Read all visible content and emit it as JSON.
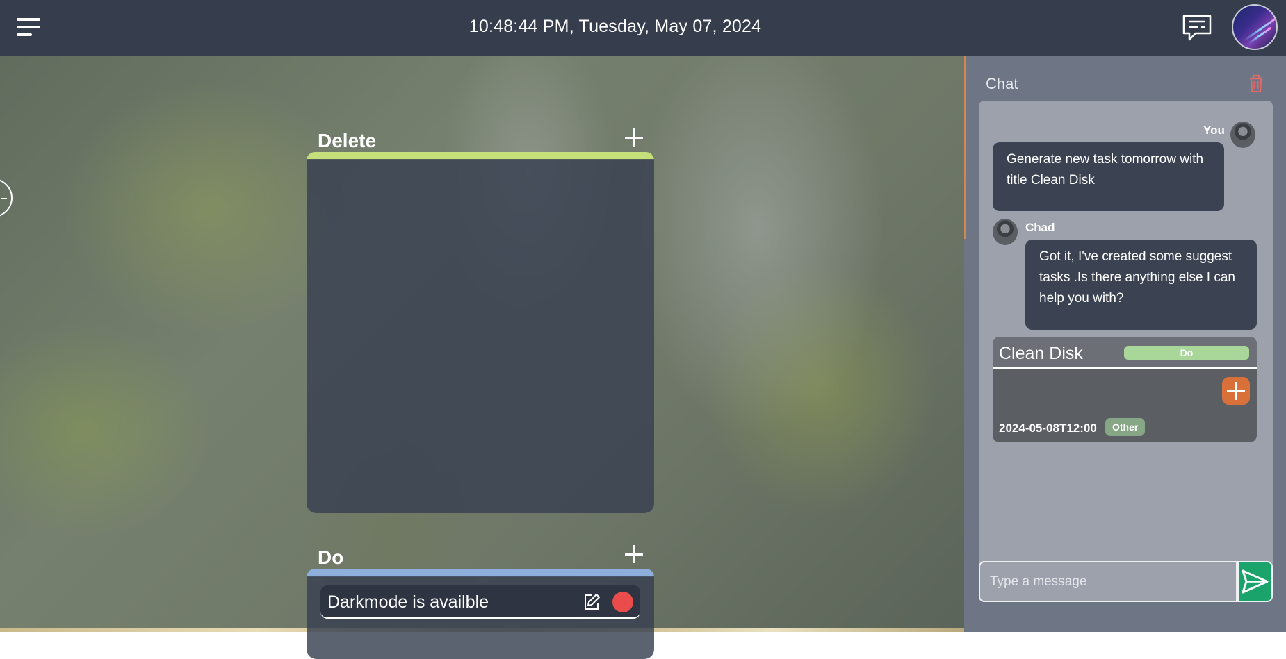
{
  "topbar": {
    "datetime": "10:48:44 PM, Tuesday, May 07, 2024",
    "menu_icon": "hamburger-menu-icon",
    "chat_icon": "chat-bubble-icon",
    "avatar": "user-avatar"
  },
  "board": {
    "columns": [
      {
        "title": "Delete",
        "color": "#c5e07a",
        "tasks": []
      },
      {
        "title": "Do",
        "color": "#8eaedb",
        "tasks": [
          {
            "title": "Darkmode is availble",
            "status_color": "#ea4b4b"
          }
        ]
      }
    ]
  },
  "chat": {
    "title": "Chat",
    "messages": [
      {
        "sender": "You",
        "text": "Generate new task tomorrow with title Clean Disk"
      },
      {
        "sender": "Chad",
        "text": "Got it, I've created some suggest tasks .Is there anything else I can help you with?"
      }
    ],
    "suggested_task": {
      "title": "Clean Disk",
      "status": "Do",
      "due": "2024-05-08T12:00",
      "category": "Other"
    },
    "input_placeholder": "Type a message",
    "send_icon": "send-arrow-icon",
    "trash_icon": "trash-icon"
  },
  "colors": {
    "topbar": "#363e4e",
    "accent_add": "#d9703a",
    "send": "#1aa36a",
    "trash": "#e06a6a"
  }
}
